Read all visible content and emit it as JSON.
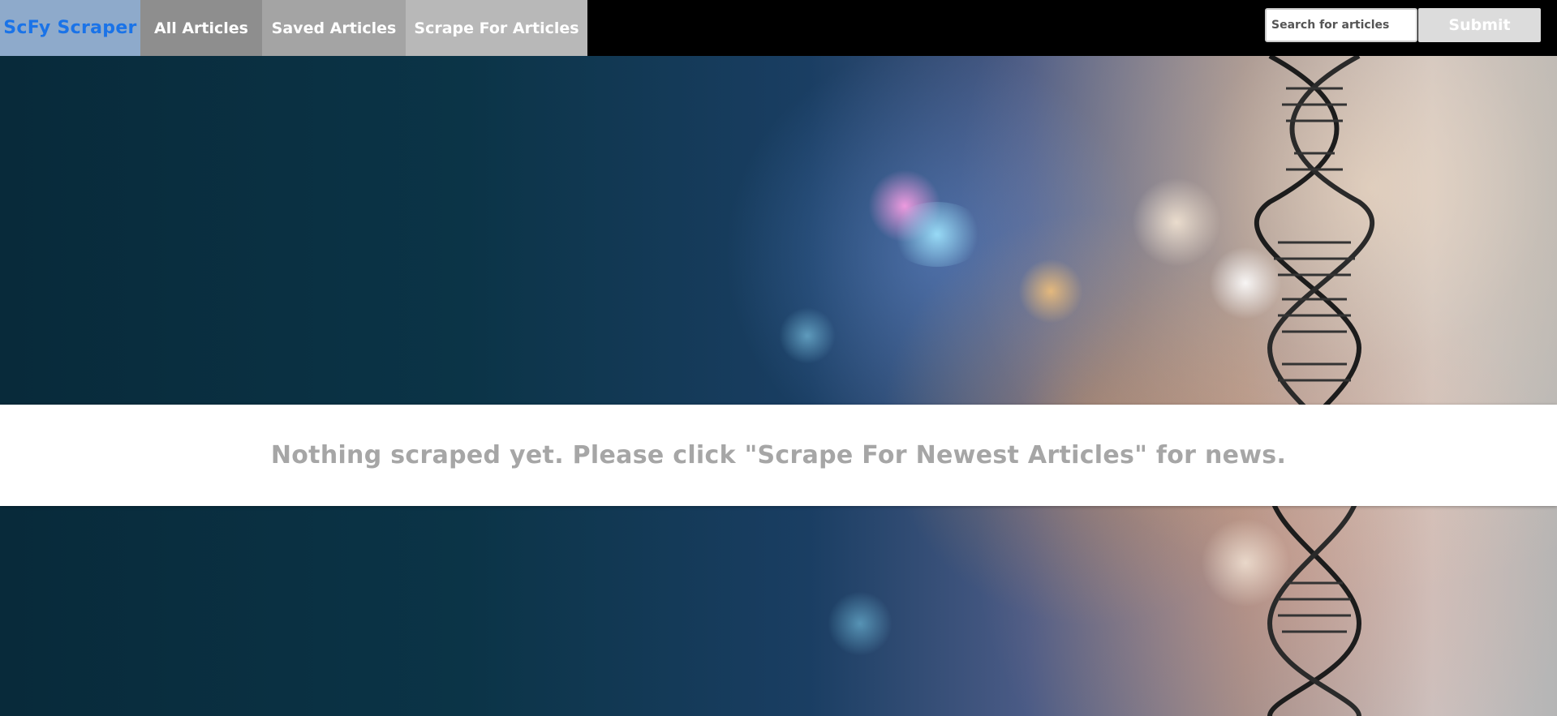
{
  "nav": {
    "brand": "ScFy Scraper",
    "links": [
      {
        "label": "All Articles"
      },
      {
        "label": "Saved Articles"
      },
      {
        "label": "Scrape For Articles"
      }
    ],
    "brand_color": "#1a73e8"
  },
  "search": {
    "placeholder": "Search for articles",
    "value": "",
    "submit_label": "Submit"
  },
  "main": {
    "message": "Nothing scraped yet. Please click \"Scrape For Newest Articles\" for news."
  },
  "icons": [
    "dna-helix-background-image"
  ]
}
